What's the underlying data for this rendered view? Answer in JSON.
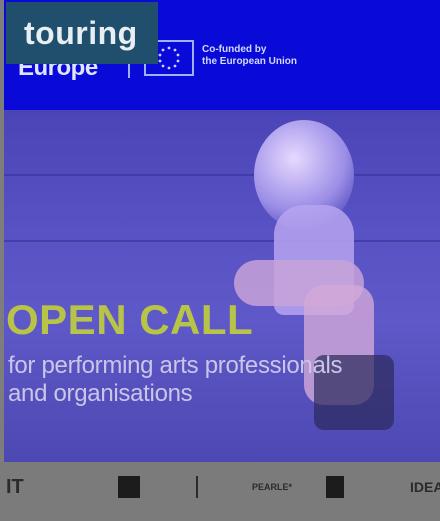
{
  "tag": {
    "label": "touring"
  },
  "banner": {
    "word": "Europe",
    "eu_line1": "Co-funded by",
    "eu_line2": "the European Union"
  },
  "poster": {
    "headline": "OPEN CALL",
    "sub_line1": "for performing arts professionals",
    "sub_line2": "and organisations"
  },
  "partner_logos": [
    "IT",
    "PEARLE*",
    "IDEA"
  ],
  "colors": {
    "banner_blue": "#0a0ad8",
    "tag_bg": "#1f4f6c",
    "headline": "#b8c448"
  }
}
